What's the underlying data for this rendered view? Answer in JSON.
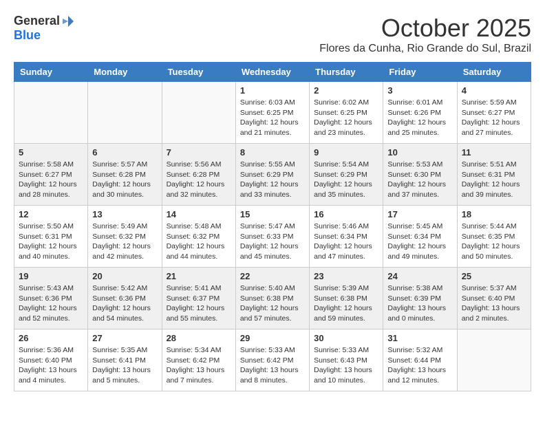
{
  "header": {
    "logo_general": "General",
    "logo_blue": "Blue",
    "month_title": "October 2025",
    "location": "Flores da Cunha, Rio Grande do Sul, Brazil"
  },
  "weekdays": [
    "Sunday",
    "Monday",
    "Tuesday",
    "Wednesday",
    "Thursday",
    "Friday",
    "Saturday"
  ],
  "weeks": [
    [
      {
        "day": "",
        "info": ""
      },
      {
        "day": "",
        "info": ""
      },
      {
        "day": "",
        "info": ""
      },
      {
        "day": "1",
        "info": "Sunrise: 6:03 AM\nSunset: 6:25 PM\nDaylight: 12 hours\nand 21 minutes."
      },
      {
        "day": "2",
        "info": "Sunrise: 6:02 AM\nSunset: 6:25 PM\nDaylight: 12 hours\nand 23 minutes."
      },
      {
        "day": "3",
        "info": "Sunrise: 6:01 AM\nSunset: 6:26 PM\nDaylight: 12 hours\nand 25 minutes."
      },
      {
        "day": "4",
        "info": "Sunrise: 5:59 AM\nSunset: 6:27 PM\nDaylight: 12 hours\nand 27 minutes."
      }
    ],
    [
      {
        "day": "5",
        "info": "Sunrise: 5:58 AM\nSunset: 6:27 PM\nDaylight: 12 hours\nand 28 minutes."
      },
      {
        "day": "6",
        "info": "Sunrise: 5:57 AM\nSunset: 6:28 PM\nDaylight: 12 hours\nand 30 minutes."
      },
      {
        "day": "7",
        "info": "Sunrise: 5:56 AM\nSunset: 6:28 PM\nDaylight: 12 hours\nand 32 minutes."
      },
      {
        "day": "8",
        "info": "Sunrise: 5:55 AM\nSunset: 6:29 PM\nDaylight: 12 hours\nand 33 minutes."
      },
      {
        "day": "9",
        "info": "Sunrise: 5:54 AM\nSunset: 6:29 PM\nDaylight: 12 hours\nand 35 minutes."
      },
      {
        "day": "10",
        "info": "Sunrise: 5:53 AM\nSunset: 6:30 PM\nDaylight: 12 hours\nand 37 minutes."
      },
      {
        "day": "11",
        "info": "Sunrise: 5:51 AM\nSunset: 6:31 PM\nDaylight: 12 hours\nand 39 minutes."
      }
    ],
    [
      {
        "day": "12",
        "info": "Sunrise: 5:50 AM\nSunset: 6:31 PM\nDaylight: 12 hours\nand 40 minutes."
      },
      {
        "day": "13",
        "info": "Sunrise: 5:49 AM\nSunset: 6:32 PM\nDaylight: 12 hours\nand 42 minutes."
      },
      {
        "day": "14",
        "info": "Sunrise: 5:48 AM\nSunset: 6:32 PM\nDaylight: 12 hours\nand 44 minutes."
      },
      {
        "day": "15",
        "info": "Sunrise: 5:47 AM\nSunset: 6:33 PM\nDaylight: 12 hours\nand 45 minutes."
      },
      {
        "day": "16",
        "info": "Sunrise: 5:46 AM\nSunset: 6:34 PM\nDaylight: 12 hours\nand 47 minutes."
      },
      {
        "day": "17",
        "info": "Sunrise: 5:45 AM\nSunset: 6:34 PM\nDaylight: 12 hours\nand 49 minutes."
      },
      {
        "day": "18",
        "info": "Sunrise: 5:44 AM\nSunset: 6:35 PM\nDaylight: 12 hours\nand 50 minutes."
      }
    ],
    [
      {
        "day": "19",
        "info": "Sunrise: 5:43 AM\nSunset: 6:36 PM\nDaylight: 12 hours\nand 52 minutes."
      },
      {
        "day": "20",
        "info": "Sunrise: 5:42 AM\nSunset: 6:36 PM\nDaylight: 12 hours\nand 54 minutes."
      },
      {
        "day": "21",
        "info": "Sunrise: 5:41 AM\nSunset: 6:37 PM\nDaylight: 12 hours\nand 55 minutes."
      },
      {
        "day": "22",
        "info": "Sunrise: 5:40 AM\nSunset: 6:38 PM\nDaylight: 12 hours\nand 57 minutes."
      },
      {
        "day": "23",
        "info": "Sunrise: 5:39 AM\nSunset: 6:38 PM\nDaylight: 12 hours\nand 59 minutes."
      },
      {
        "day": "24",
        "info": "Sunrise: 5:38 AM\nSunset: 6:39 PM\nDaylight: 13 hours\nand 0 minutes."
      },
      {
        "day": "25",
        "info": "Sunrise: 5:37 AM\nSunset: 6:40 PM\nDaylight: 13 hours\nand 2 minutes."
      }
    ],
    [
      {
        "day": "26",
        "info": "Sunrise: 5:36 AM\nSunset: 6:40 PM\nDaylight: 13 hours\nand 4 minutes."
      },
      {
        "day": "27",
        "info": "Sunrise: 5:35 AM\nSunset: 6:41 PM\nDaylight: 13 hours\nand 5 minutes."
      },
      {
        "day": "28",
        "info": "Sunrise: 5:34 AM\nSunset: 6:42 PM\nDaylight: 13 hours\nand 7 minutes."
      },
      {
        "day": "29",
        "info": "Sunrise: 5:33 AM\nSunset: 6:42 PM\nDaylight: 13 hours\nand 8 minutes."
      },
      {
        "day": "30",
        "info": "Sunrise: 5:33 AM\nSunset: 6:43 PM\nDaylight: 13 hours\nand 10 minutes."
      },
      {
        "day": "31",
        "info": "Sunrise: 5:32 AM\nSunset: 6:44 PM\nDaylight: 13 hours\nand 12 minutes."
      },
      {
        "day": "",
        "info": ""
      }
    ]
  ]
}
